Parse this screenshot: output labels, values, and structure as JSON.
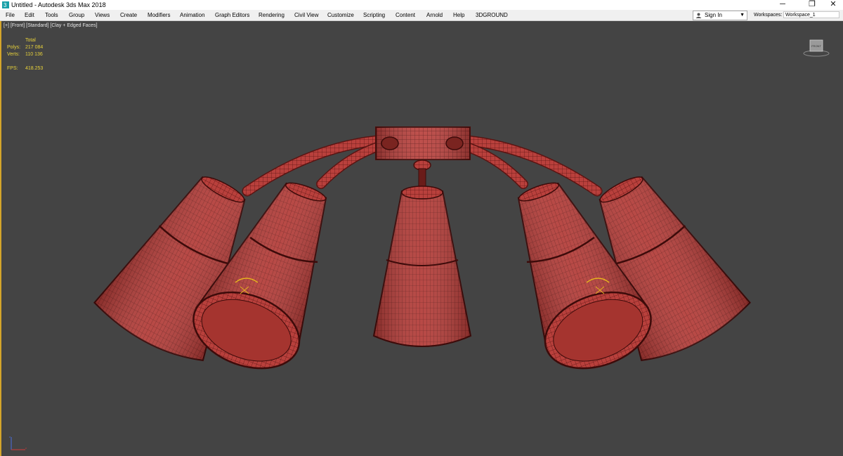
{
  "window": {
    "title": "Untitled - Autodesk 3ds Max 2018",
    "controls": {
      "minimize": "─",
      "maximize": "❐",
      "close": "✕"
    }
  },
  "menu": {
    "items": [
      "File",
      "Edit",
      "Tools",
      "Group",
      "Views",
      "Create",
      "Modifiers",
      "Animation",
      "Graph Editors",
      "Rendering",
      "Civil View",
      "Customize",
      "Scripting",
      "Content",
      "Arnold",
      "Help",
      "3DGROUND"
    ]
  },
  "account": {
    "signin_label": "Sign In",
    "workspaces_label": "Workspaces:",
    "workspace_value": "Workspace_1"
  },
  "viewport": {
    "label_plus": "[+]",
    "label_view": "[Front]",
    "label_shading": "[Standard]",
    "label_style": "[Clay + Edged Faces]",
    "stats": {
      "header": "Total",
      "polys_label": "Polys:",
      "polys_value": "217 084",
      "verts_label": "Verts:",
      "verts_value": "110 136",
      "fps_label": "FPS:",
      "fps_value": "418.253"
    },
    "viewcube_label": "FRONT"
  },
  "colors": {
    "viewport_bg": "#444444",
    "mesh": "#b9403c",
    "wire": "#5a1412",
    "active_border": "#d4a52a",
    "stats_text": "#e8d23a"
  },
  "icons": {
    "app": "3dsmax-app-icon",
    "user": "user-icon",
    "dropdown": "chevron-down-icon",
    "axis": "axis-tripod-icon",
    "viewcube": "viewcube-icon"
  }
}
